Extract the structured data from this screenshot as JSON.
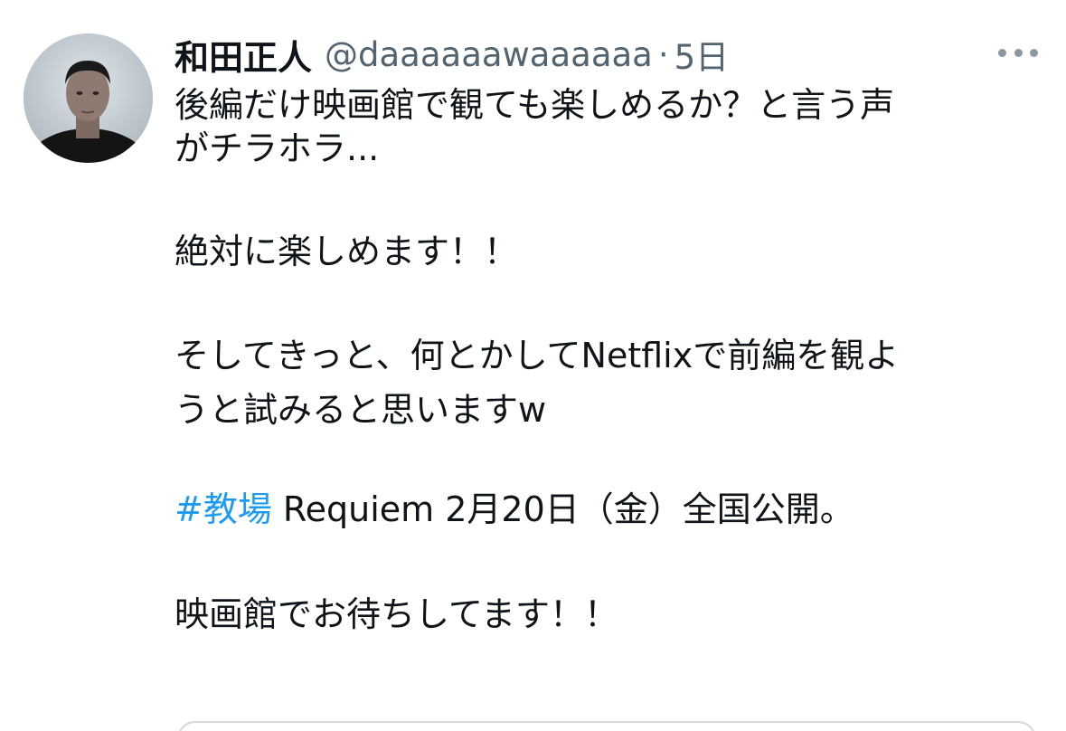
{
  "tweet": {
    "author": {
      "display_name": "和田正人",
      "handle": "@daaaaaawaaaaaa",
      "separator": "·",
      "timestamp": "5日"
    },
    "more_icon": "more-horizontal-icon",
    "text": {
      "line1": "後編だけ映画館で観ても楽しめるか？と言う声",
      "line2": "がチラホラ...",
      "line3": "絶対に楽しめます！！",
      "line4": "そしてきっと、何とかしてNetflixで前編を観よ",
      "line5": "うと試みると思いますw",
      "hashtag": "#教場",
      "line6_rest": " Requiem 2月20日（金）全国公開。",
      "line7": "映画館でお待ちしてます！！"
    },
    "colors": {
      "hashtag": "#1d9bf0",
      "secondary_text": "#536471"
    }
  }
}
